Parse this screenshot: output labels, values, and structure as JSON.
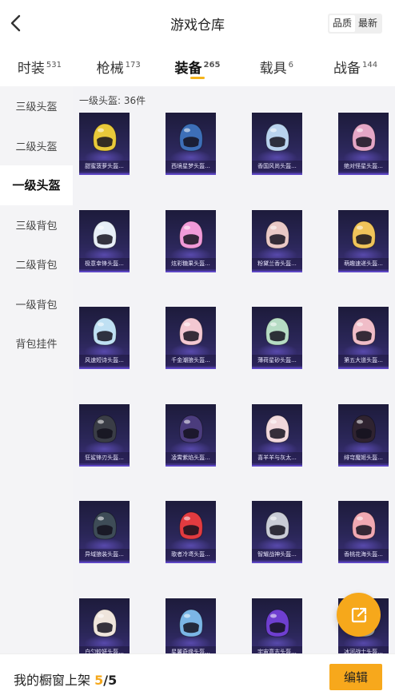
{
  "header": {
    "title": "游戏仓库",
    "sort_options": [
      {
        "label": "品质",
        "active": true
      },
      {
        "label": "最新",
        "active": false
      }
    ]
  },
  "tabs": [
    {
      "label": "时装",
      "count": "531",
      "active": false
    },
    {
      "label": "枪械",
      "count": "173",
      "active": false
    },
    {
      "label": "装备",
      "count": "265",
      "active": true
    },
    {
      "label": "载具",
      "count": "6",
      "active": false
    },
    {
      "label": "战备",
      "count": "144",
      "active": false
    }
  ],
  "sidebar": {
    "items": [
      {
        "label": "三级头盔",
        "active": false
      },
      {
        "label": "二级头盔",
        "active": false
      },
      {
        "label": "一级头盔",
        "active": true
      },
      {
        "label": "三级背包",
        "active": false
      },
      {
        "label": "二级背包",
        "active": false
      },
      {
        "label": "一级背包",
        "active": false
      },
      {
        "label": "背包挂件",
        "active": false
      }
    ]
  },
  "main": {
    "subtitle": "一级头盔: 36件",
    "items": [
      {
        "name": "甜蜜菠萝头盔...",
        "color": "#e8c93a"
      },
      {
        "name": "西境星梦头盔...",
        "color": "#3d6fb8"
      },
      {
        "name": "香国风尚头盔...",
        "color": "#b9d3ef"
      },
      {
        "name": "绝对怪星头盔...",
        "color": "#e4a6c6"
      },
      {
        "name": "极意幸锋头盔...",
        "color": "#e7eef7"
      },
      {
        "name": "炫彩糖果头盔...",
        "color": "#f19ad8"
      },
      {
        "name": "粉黛兰香头盔...",
        "color": "#e9c9c6"
      },
      {
        "name": "萌趣速递头盔...",
        "color": "#f0c45a"
      },
      {
        "name": "风速短诗头盔...",
        "color": "#bfe0f3"
      },
      {
        "name": "千金潮狼头盔...",
        "color": "#f3c8d2"
      },
      {
        "name": "薄荷星砂头盔...",
        "color": "#b6dcc4"
      },
      {
        "name": "第五大道头盔...",
        "color": "#f0bdc8"
      },
      {
        "name": "狂鲨锋刃头盔...",
        "color": "#3a3d46"
      },
      {
        "name": "凌霄紫焰头盔...",
        "color": "#4b3c7d"
      },
      {
        "name": "喜羊羊与灰太...",
        "color": "#f1d8dc"
      },
      {
        "name": "绯穹魔姬头盔...",
        "color": "#2f2330"
      },
      {
        "name": "异域狼装头盔...",
        "color": "#3e4c57"
      },
      {
        "name": "歌者冷鸢头盔...",
        "color": "#e23b40"
      },
      {
        "name": "智耀战神头盔...",
        "color": "#c9ccd6"
      },
      {
        "name": "香桃花海头盔...",
        "color": "#f0a8b2"
      },
      {
        "name": "白勺蛟妍头盔...",
        "color": "#efe5dc"
      },
      {
        "name": "星翼奇缘头盔...",
        "color": "#7bb6e6"
      },
      {
        "name": "宇宙意志头盔...",
        "color": "#6f3fd0"
      },
      {
        "name": "冰河战士头盔...",
        "color": "#9aa3b6"
      }
    ]
  },
  "share_button": {
    "icon": "share-external-icon"
  },
  "bottom_bar": {
    "label": "我的橱窗上架",
    "current": "5",
    "separator": "/",
    "total": "5",
    "edit_label": "编辑"
  }
}
